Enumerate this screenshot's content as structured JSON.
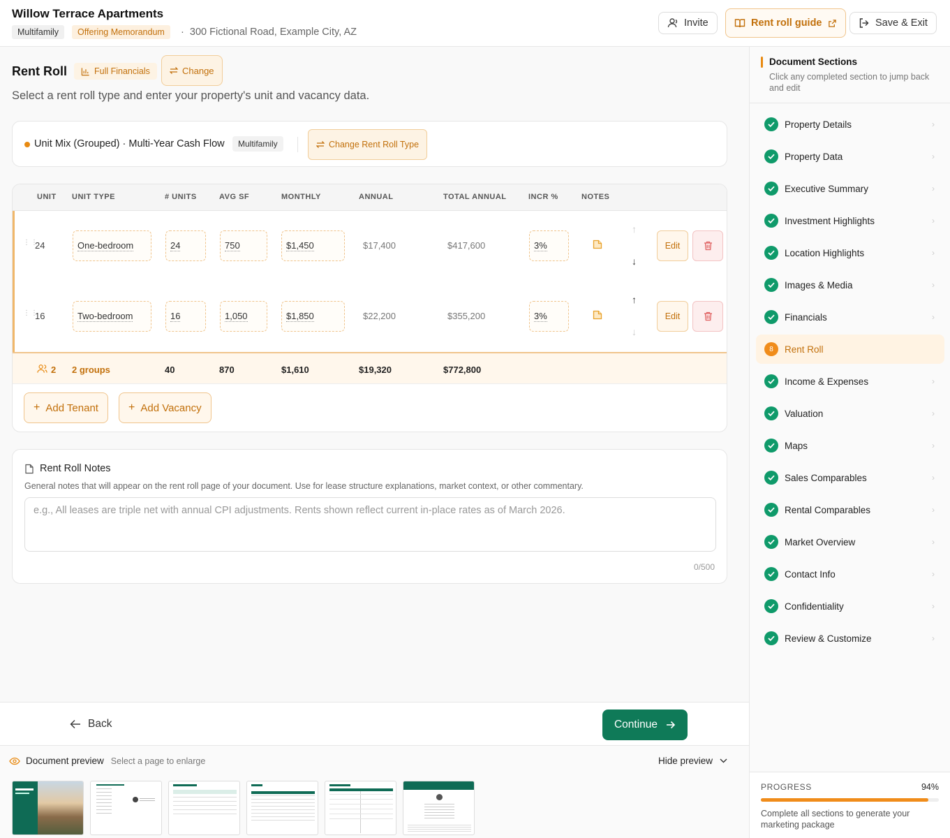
{
  "header": {
    "title": "Willow Terrace Apartments",
    "property_type": "Multifamily",
    "doc_type": "Offering Memorandum",
    "address": "300 Fictional Road, Example City, AZ",
    "invite_label": "Invite",
    "guide_label": "Rent roll guide",
    "save_label": "Save & Exit"
  },
  "rentroll": {
    "title": "Rent Roll",
    "tag": "Full Financials",
    "change_label": "Change",
    "subtitle": "Select a rent roll type and enter your property's unit and vacancy data.",
    "type_label": "Unit Mix (Grouped) · Multi-Year Cash Flow",
    "type_chip": "Multifamily",
    "change_type_label": "Change Rent Roll Type",
    "columns": [
      "UNIT",
      "UNIT TYPE",
      "# UNITS",
      "AVG SF",
      "MONTHLY",
      "ANNUAL",
      "TOTAL ANNUAL",
      "INCR %",
      "NOTES"
    ],
    "rows": [
      {
        "unit": "24",
        "type": "One-bedroom",
        "units": "24",
        "sf": "750",
        "monthly": "$1,450",
        "annual": "$17,400",
        "total": "$417,600",
        "incr": "3%",
        "edit": "Edit"
      },
      {
        "unit": "16",
        "type": "Two-bedroom",
        "units": "16",
        "sf": "1,050",
        "monthly": "$1,850",
        "annual": "$22,200",
        "total": "$355,200",
        "incr": "3%",
        "edit": "Edit"
      }
    ],
    "totals": {
      "count": "2",
      "groups": "2 groups",
      "units": "40",
      "sf": "870",
      "monthly": "$1,610",
      "annual": "$19,320",
      "total": "$772,800"
    },
    "add_tenant": "Add Tenant",
    "add_vacancy": "Add Vacancy"
  },
  "notes": {
    "title": "Rent Roll Notes",
    "help": "General notes that will appear on the rent roll page of your document. Use for lease structure explanations, market context, or other commentary.",
    "placeholder": "e.g., All leases are triple net with annual CPI adjustments. Rents shown reflect current in-place rates as of March 2026.",
    "count": "0/500"
  },
  "nav": {
    "back": "Back",
    "continue": "Continue"
  },
  "preview": {
    "title": "Document preview",
    "help": "Select a page to enlarge",
    "hide": "Hide preview"
  },
  "sidebar": {
    "title": "Document Sections",
    "subtitle": "Click any completed section to jump back and edit",
    "sections": [
      {
        "label": "Property Details"
      },
      {
        "label": "Property Data"
      },
      {
        "label": "Executive Summary"
      },
      {
        "label": "Investment Highlights"
      },
      {
        "label": "Location Highlights"
      },
      {
        "label": "Images & Media"
      },
      {
        "label": "Financials"
      },
      {
        "label": "Rent Roll",
        "number": "8"
      },
      {
        "label": "Income & Expenses"
      },
      {
        "label": "Valuation"
      },
      {
        "label": "Maps"
      },
      {
        "label": "Sales Comparables"
      },
      {
        "label": "Rental Comparables"
      },
      {
        "label": "Market Overview"
      },
      {
        "label": "Contact Info"
      },
      {
        "label": "Confidentiality"
      },
      {
        "label": "Review & Customize"
      }
    ],
    "progress_label": "PROGRESS",
    "progress_value": "94%",
    "progress_fraction": 0.94,
    "progress_note": "Complete all sections to generate your marketing package"
  },
  "colors": {
    "accent": "#e88a12",
    "primary": "#0f7a58",
    "success": "#0f9a6a",
    "danger": "#e06060"
  }
}
